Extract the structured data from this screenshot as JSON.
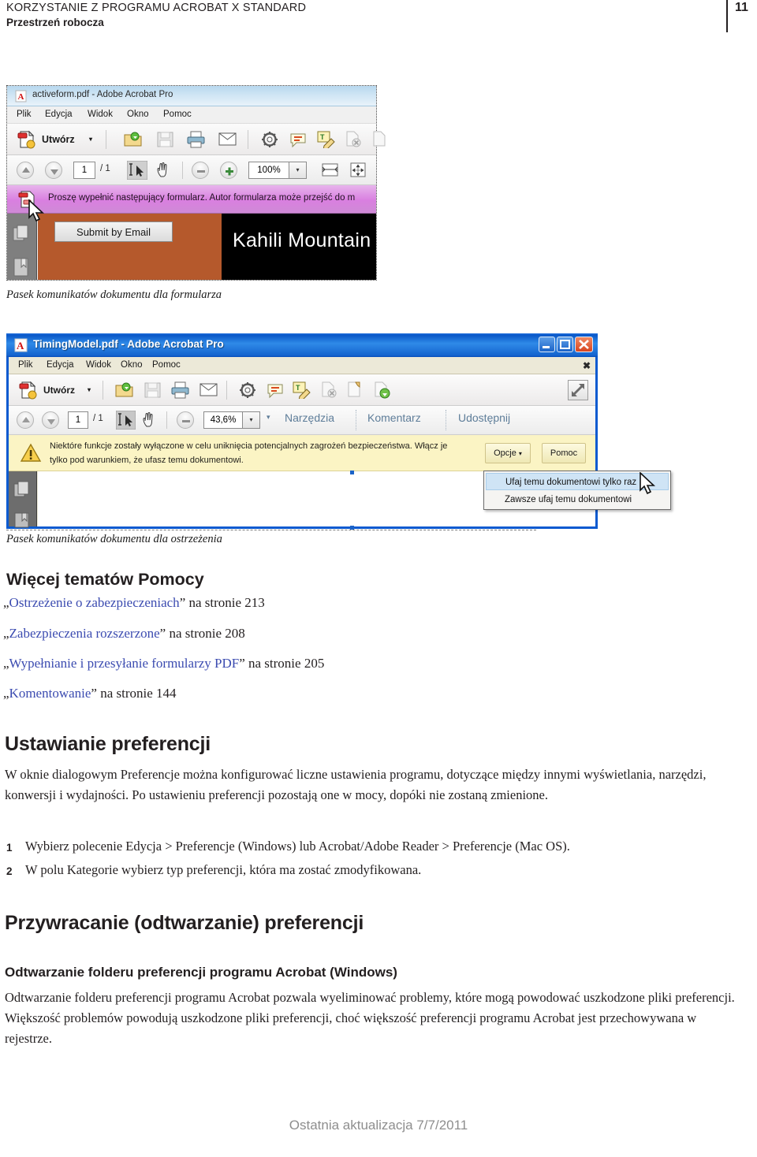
{
  "header": {
    "running_title": "KORZYSTANIE Z PROGRAMU ACROBAT X STANDARD",
    "section": "Przestrzeń robocza",
    "page_number": "11"
  },
  "shot1": {
    "window_title": "activeform.pdf - Adobe Acrobat Pro",
    "menus": [
      "Plik",
      "Edycja",
      "Widok",
      "Okno",
      "Pomoc"
    ],
    "create_button": "Utwórz",
    "create_caret": "▾",
    "page_current": "1",
    "page_total": "/ 1",
    "zoom_value": "100%",
    "zoom_caret": "▾",
    "message": "Proszę wypełnić następujący formularz. Autor formularza może przejść do m",
    "submit_button": "Submit by Email",
    "doc_heading": "Kahili Mountain",
    "icons": [
      "create-pdf-icon",
      "open-folder-icon",
      "save-icon",
      "print-icon",
      "email-icon",
      "gear-icon",
      "comment-bubble-icon",
      "text-edit-icon",
      "redact-icon",
      "sign-icon"
    ],
    "nav_icons": [
      "page-thumbnails-icon",
      "bookmarks-icon"
    ]
  },
  "caption1": "Pasek komunikatów dokumentu dla formularza",
  "shot2": {
    "window_title": "TimingModel.pdf - Adobe Acrobat Pro",
    "menus": [
      "Plik",
      "Edycja",
      "Widok",
      "Okno",
      "Pomoc"
    ],
    "menubar_close": "✖",
    "create_button": "Utwórz",
    "create_caret": "▾",
    "page_current": "1",
    "page_total": "/ 1",
    "zoom_value": "43,6%",
    "zoom_caret": "▾",
    "extra_caret": "▾",
    "task_panes": [
      "Narzędzia",
      "Komentarz",
      "Udostępnij"
    ],
    "warning_line1": "Niektóre funkcje zostały wyłączone w celu uniknięcia potencjalnych zagrożeń bezpieczeństwa. Włącz je",
    "warning_line2": "tylko pod warunkiem, że ufasz temu dokumentowi.",
    "options_button": "Opcje",
    "options_caret": "▾",
    "help_button": "Pomoc",
    "window_buttons": [
      "minimize-button",
      "maximize-button",
      "close-button"
    ],
    "context_menu": [
      "Ufaj temu dokumentowi tylko raz",
      "Zawsze ufaj temu dokumentowi"
    ],
    "icons": [
      "create-pdf-icon",
      "open-folder-icon",
      "save-icon",
      "print-icon",
      "email-icon",
      "gear-icon",
      "comment-bubble-icon",
      "text-edit-icon",
      "redact-icon",
      "sign-icon",
      "stamp-icon",
      "expand-icon"
    ]
  },
  "caption2": "Pasek komunikatów dokumentu dla ostrzeżenia",
  "more_help": {
    "heading": "Więcej tematów Pomocy",
    "links": [
      {
        "open_quote": "„",
        "text": "Ostrzeżenie o zabezpieczeniach",
        "close_quote": "”",
        "suffix": " na stronie 213"
      },
      {
        "open_quote": "„",
        "text": "Zabezpieczenia rozszerzone",
        "close_quote": "”",
        "suffix": " na stronie 208"
      },
      {
        "open_quote": "„",
        "text": "Wypełnianie i przesyłanie formularzy PDF",
        "close_quote": "”",
        "suffix": " na stronie 205"
      },
      {
        "open_quote": "„",
        "text": "Komentowanie",
        "close_quote": "”",
        "suffix": " na stronie 144"
      }
    ]
  },
  "prefs": {
    "heading": "Ustawianie preferencji",
    "paragraph": "W oknie dialogowym Preferencje można konfigurować liczne ustawienia programu, dotyczące między innymi wyświetlania, narzędzi, konwersji i wydajności. Po ustawieniu preferencji pozostają one w mocy, dopóki nie zostaną zmienione.",
    "steps": [
      {
        "num": "1",
        "text": "Wybierz polecenie Edycja > Preferencje (Windows) lub Acrobat/Adobe Reader > Preferencje (Mac OS)."
      },
      {
        "num": "2",
        "text": "W polu Kategorie wybierz typ preferencji, która ma zostać zmodyfikowana."
      }
    ]
  },
  "restore": {
    "heading": "Przywracanie (odtwarzanie) preferencji",
    "subheading": "Odtwarzanie folderu preferencji programu Acrobat (Windows)",
    "paragraph": "Odtwarzanie folderu preferencji programu Acrobat pozwala wyeliminować problemy, które mogą powodować uszkodzone pliki preferencji. Większość problemów powodują uszkodzone pliki preferencji, choć większość preferencji programu Acrobat jest przechowywana w rejestrze."
  },
  "footer": "Ostatnia aktualizacja 7/7/2011",
  "colors": {
    "link": "#3b4bb0",
    "form_msgbar": "#d97fe0",
    "warning_msgbar": "#fbf4c4",
    "xp_titlebar": "#0a5ad0",
    "doc_accent": "#b5592c",
    "footer_text": "#8e8e8e"
  }
}
